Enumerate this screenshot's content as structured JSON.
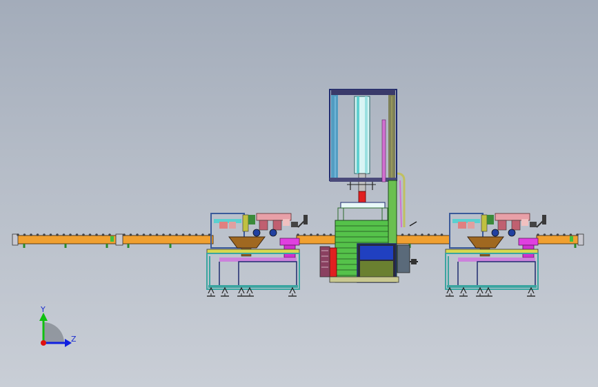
{
  "colors": {
    "background_top": "#a3acba",
    "background_bottom": "#c9ced6",
    "conveyor": "#f0a030",
    "frame_outline": "#1e2a6e",
    "frame_teal": "#3aa5a0",
    "frame_yellow": "#d8d850",
    "green_stack": "#55c24a",
    "magenta": "#e040e0",
    "bronze": "#a06820",
    "blue_box": "#2040c0",
    "olive_box": "#6a8030",
    "red_part": "#e02020"
  },
  "triad": {
    "y_label": "Y",
    "z_label": "Z",
    "icons": [
      "y-axis-arrow-icon",
      "z-axis-arrow-icon",
      "origin-icon"
    ]
  }
}
